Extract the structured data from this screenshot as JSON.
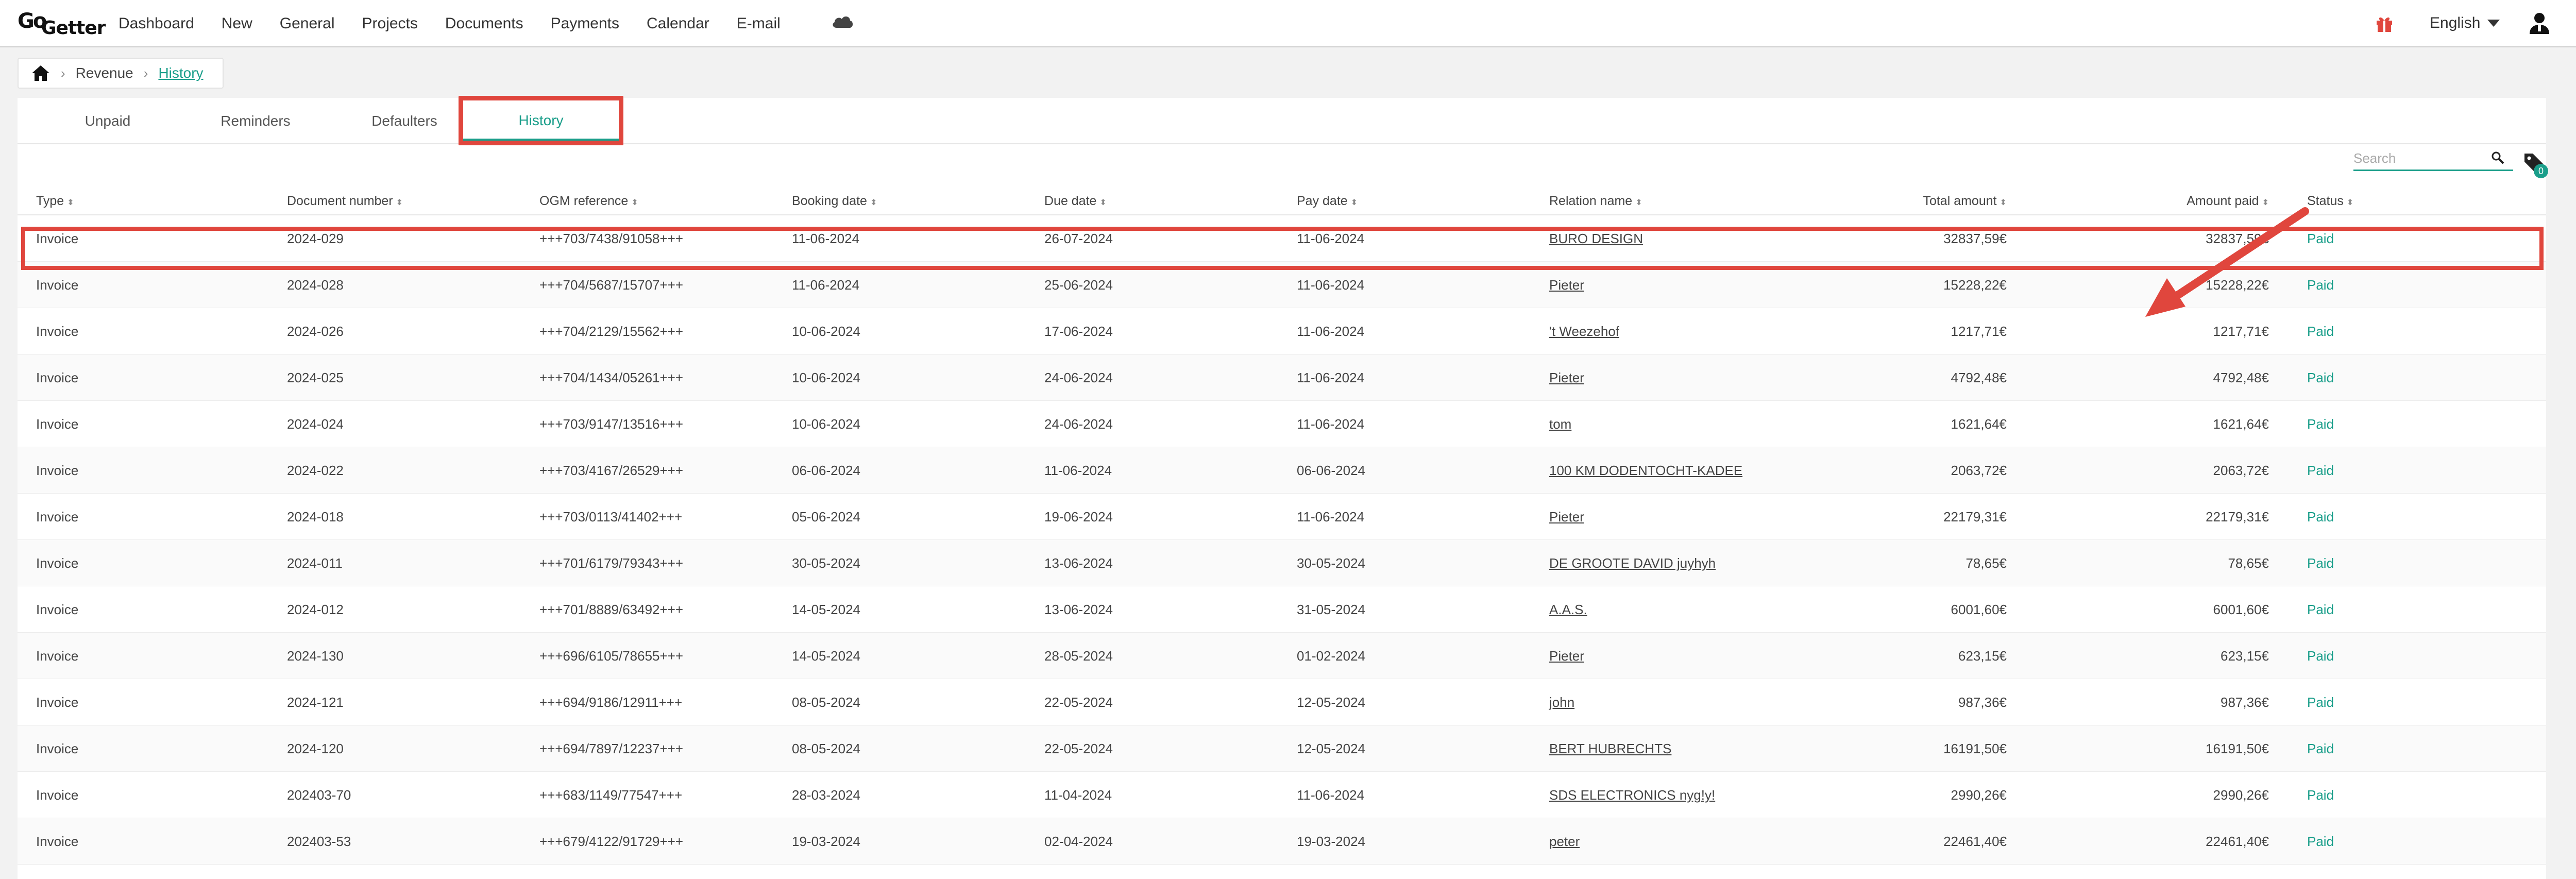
{
  "brand": {
    "logo_top": "Go",
    "logo_bottom": "Getter"
  },
  "nav": {
    "items": [
      "Dashboard",
      "New",
      "General",
      "Projects",
      "Documents",
      "Payments",
      "Calendar",
      "E-mail"
    ],
    "language": "English"
  },
  "breadcrumb": {
    "items": [
      "Revenue",
      "History"
    ]
  },
  "tabs": [
    "Unpaid",
    "Reminders",
    "Defaulters",
    "History"
  ],
  "active_tab": "History",
  "search": {
    "placeholder": "Search"
  },
  "tag_badge_count": "0",
  "table": {
    "headers": [
      "Type",
      "Document number",
      "OGM reference",
      "Booking date",
      "Due date",
      "Pay date",
      "Relation name",
      "Total amount",
      "Amount paid",
      "Status"
    ],
    "rows": [
      [
        "Invoice",
        "2024-029",
        "+++703/7438/91058+++",
        "11-06-2024",
        "26-07-2024",
        "11-06-2024",
        "BURO DESIGN",
        "32837,59€",
        "32837,59€",
        "Paid"
      ],
      [
        "Invoice",
        "2024-028",
        "+++704/5687/15707+++",
        "11-06-2024",
        "25-06-2024",
        "11-06-2024",
        "Pieter",
        "15228,22€",
        "15228,22€",
        "Paid"
      ],
      [
        "Invoice",
        "2024-026",
        "+++704/2129/15562+++",
        "10-06-2024",
        "17-06-2024",
        "11-06-2024",
        "'t Weezehof",
        "1217,71€",
        "1217,71€",
        "Paid"
      ],
      [
        "Invoice",
        "2024-025",
        "+++704/1434/05261+++",
        "10-06-2024",
        "24-06-2024",
        "11-06-2024",
        "Pieter",
        "4792,48€",
        "4792,48€",
        "Paid"
      ],
      [
        "Invoice",
        "2024-024",
        "+++703/9147/13516+++",
        "10-06-2024",
        "24-06-2024",
        "11-06-2024",
        "tom",
        "1621,64€",
        "1621,64€",
        "Paid"
      ],
      [
        "Invoice",
        "2024-022",
        "+++703/4167/26529+++",
        "06-06-2024",
        "11-06-2024",
        "06-06-2024",
        "100 KM DODENTOCHT-KADEE",
        "2063,72€",
        "2063,72€",
        "Paid"
      ],
      [
        "Invoice",
        "2024-018",
        "+++703/0113/41402+++",
        "05-06-2024",
        "19-06-2024",
        "11-06-2024",
        "Pieter",
        "22179,31€",
        "22179,31€",
        "Paid"
      ],
      [
        "Invoice",
        "2024-011",
        "+++701/6179/79343+++",
        "30-05-2024",
        "13-06-2024",
        "30-05-2024",
        "DE GROOTE DAVID juyhyh",
        "78,65€",
        "78,65€",
        "Paid"
      ],
      [
        "Invoice",
        "2024-012",
        "+++701/8889/63492+++",
        "14-05-2024",
        "13-06-2024",
        "31-05-2024",
        "A.A.S.",
        "6001,60€",
        "6001,60€",
        "Paid"
      ],
      [
        "Invoice",
        "2024-130",
        "+++696/6105/78655+++",
        "14-05-2024",
        "28-05-2024",
        "01-02-2024",
        "Pieter",
        "623,15€",
        "623,15€",
        "Paid"
      ],
      [
        "Invoice",
        "2024-121",
        "+++694/9186/12911+++",
        "08-05-2024",
        "22-05-2024",
        "12-05-2024",
        "john",
        "987,36€",
        "987,36€",
        "Paid"
      ],
      [
        "Invoice",
        "2024-120",
        "+++694/7897/12237+++",
        "08-05-2024",
        "22-05-2024",
        "12-05-2024",
        "BERT HUBRECHTS",
        "16191,50€",
        "16191,50€",
        "Paid"
      ],
      [
        "Invoice",
        "202403-70",
        "+++683/1149/77547+++",
        "28-03-2024",
        "11-04-2024",
        "11-06-2024",
        "SDS ELECTRONICS nyg!y!",
        "2990,26€",
        "2990,26€",
        "Paid"
      ],
      [
        "Invoice",
        "202403-53",
        "+++679/4122/91729+++",
        "19-03-2024",
        "02-04-2024",
        "19-03-2024",
        "peter",
        "22461,40€",
        "22461,40€",
        "Paid"
      ]
    ]
  },
  "colors": {
    "accent": "#1a9e8a",
    "highlight": "#e0463d",
    "gift": "#e0463d"
  },
  "icons": [
    "home-icon",
    "cloud-icon",
    "gift-icon",
    "user-icon",
    "search-icon",
    "tag-icon"
  ]
}
